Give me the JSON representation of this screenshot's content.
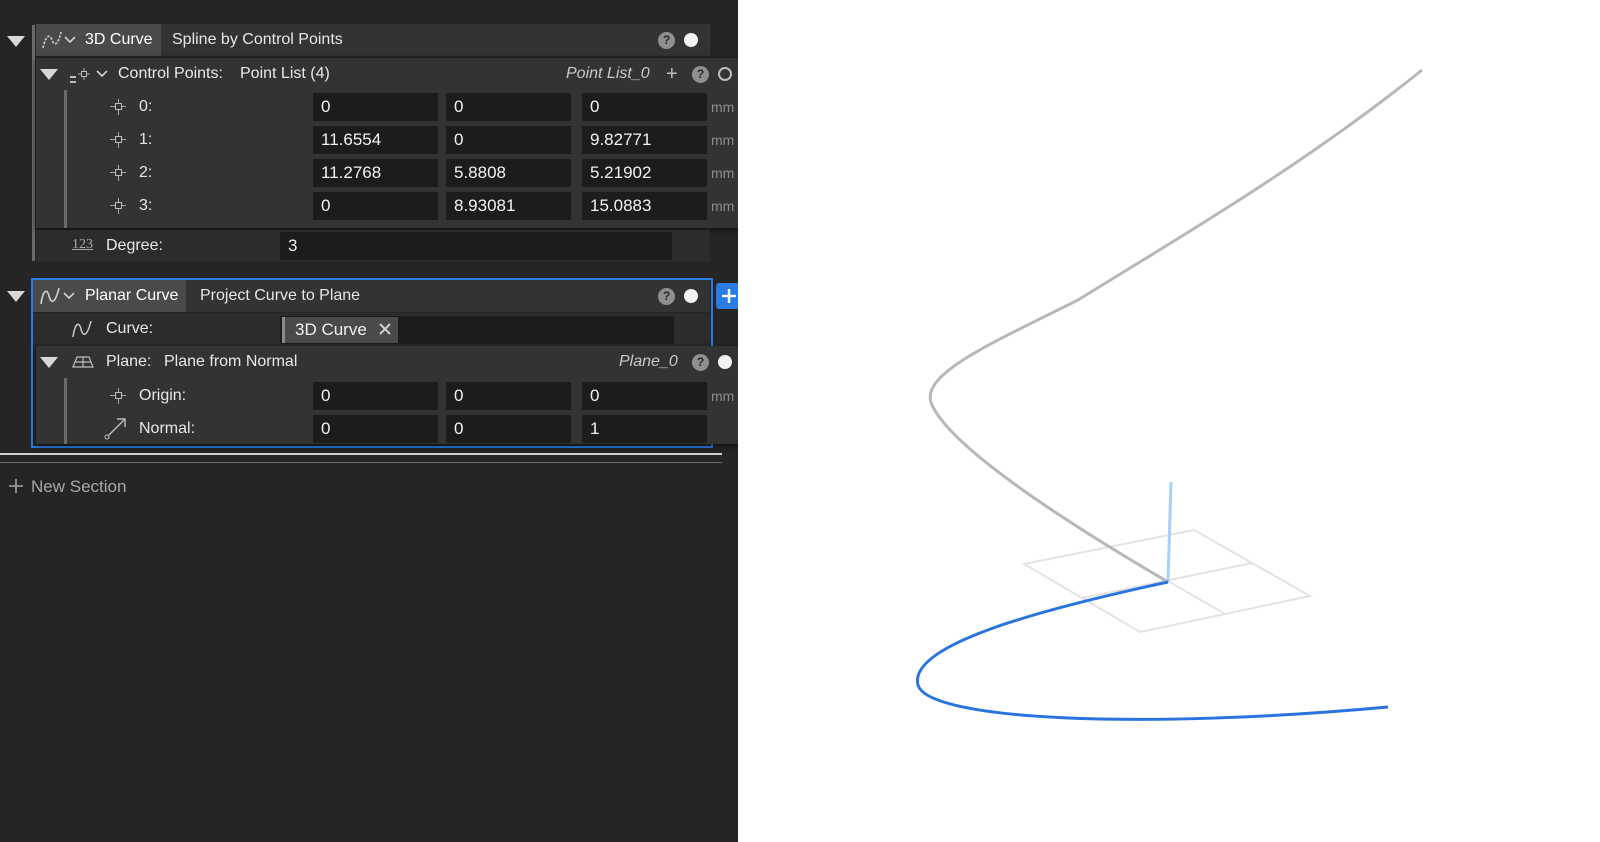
{
  "feature1": {
    "name": "3D Curve",
    "operation": "Spline by Control Points",
    "control_points": {
      "label": "Control Points:",
      "value": "Point List (4)",
      "ref": "Point List_0",
      "unit": "mm",
      "rows": [
        {
          "label": "0:",
          "x": "0",
          "y": "0",
          "z": "0"
        },
        {
          "label": "1:",
          "x": "11.6554",
          "y": "0",
          "z": "9.82771"
        },
        {
          "label": "2:",
          "x": "11.2768",
          "y": "5.8808",
          "z": "5.21902"
        },
        {
          "label": "3:",
          "x": "0",
          "y": "8.93081",
          "z": "15.0883"
        }
      ]
    },
    "degree": {
      "icon_text": "123",
      "label": "Degree:",
      "value": "3"
    }
  },
  "feature2": {
    "name": "Planar Curve",
    "operation": "Project Curve to Plane",
    "curve": {
      "label": "Curve:",
      "chip": "3D Curve"
    },
    "plane": {
      "label": "Plane:",
      "value": "Plane from Normal",
      "ref": "Plane_0",
      "unit": "mm",
      "origin": {
        "label": "Origin:",
        "x": "0",
        "y": "0",
        "z": "0"
      },
      "normal": {
        "label": "Normal:",
        "x": "0",
        "y": "0",
        "z": "1"
      }
    }
  },
  "help_glyph": "?",
  "new_section": "New Section",
  "colors": {
    "accent": "#2b7be4",
    "panel": "#252525",
    "curve3d": "#b8b8b8",
    "projected": "#2a74e0"
  },
  "icons": [
    "chevron-down-icon",
    "curve-3d-icon",
    "point-list-icon",
    "point-icon",
    "number-icon",
    "planar-curve-icon",
    "plane-icon",
    "vector-icon",
    "help-icon",
    "plus-icon",
    "close-icon"
  ]
}
